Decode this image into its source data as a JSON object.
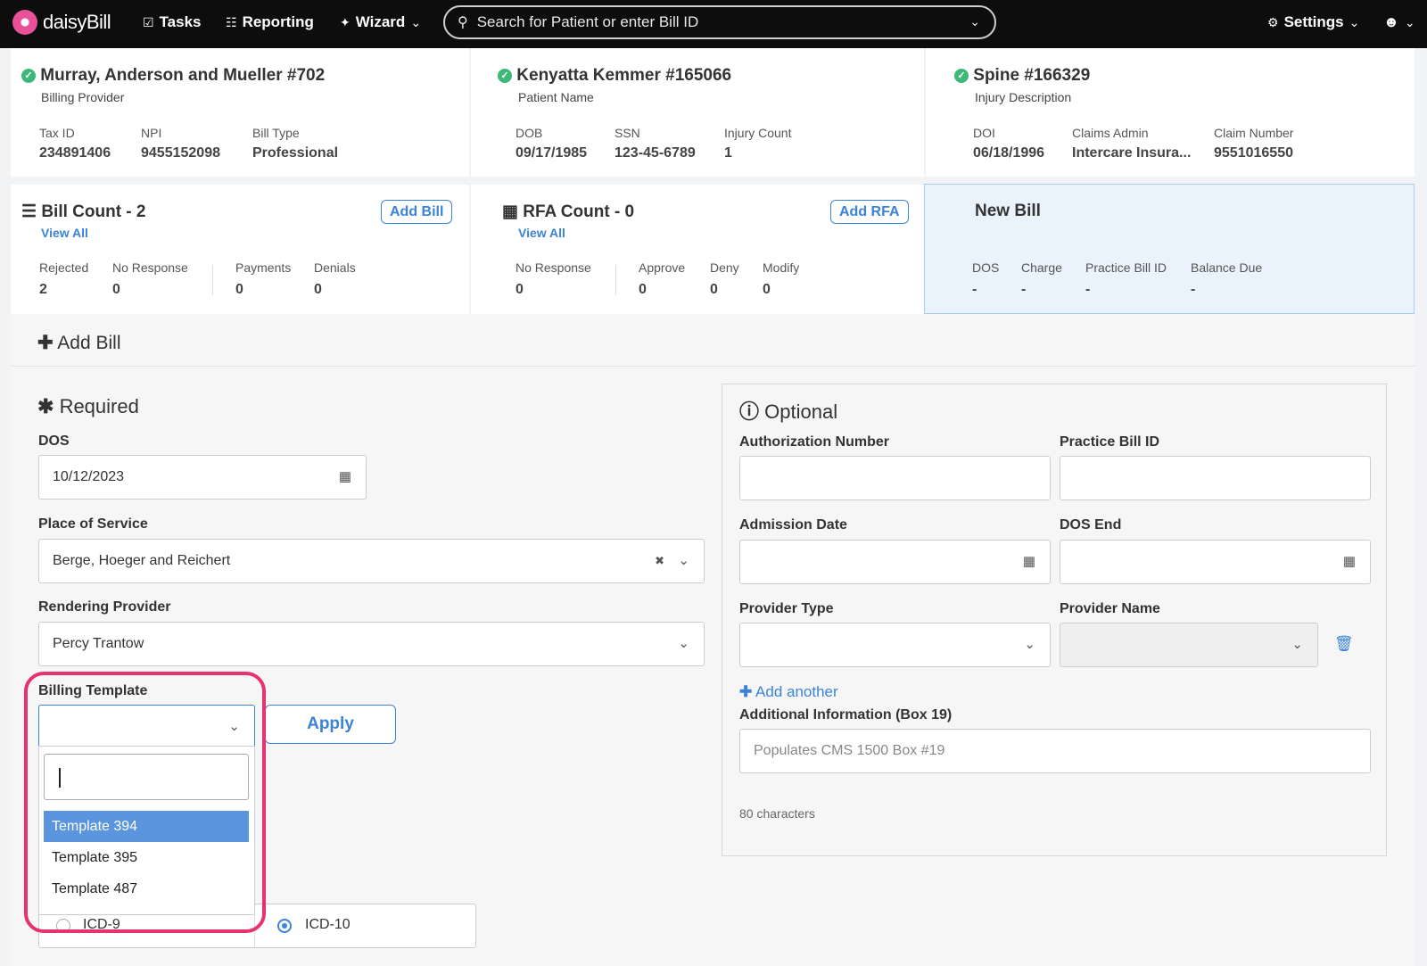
{
  "nav": {
    "brand": "daisyBill",
    "tasks": "Tasks",
    "reporting": "Reporting",
    "wizard": "Wizard",
    "search_placeholder": "Search for Patient or enter Bill ID",
    "settings": "Settings"
  },
  "provider_card": {
    "title": "Murray, Anderson and Mueller #702",
    "subtitle": "Billing Provider",
    "fields": [
      {
        "label": "Tax ID",
        "value": "234891406"
      },
      {
        "label": "NPI",
        "value": "9455152098"
      },
      {
        "label": "Bill Type",
        "value": "Professional"
      }
    ]
  },
  "patient_card": {
    "title": "Kenyatta Kemmer #165066",
    "subtitle": "Patient Name",
    "fields": [
      {
        "label": "DOB",
        "value": "09/17/1985"
      },
      {
        "label": "SSN",
        "value": "123-45-6789"
      },
      {
        "label": "Injury Count",
        "value": "1"
      }
    ]
  },
  "injury_card": {
    "title": "Spine #166329",
    "subtitle": "Injury Description",
    "fields": [
      {
        "label": "DOI",
        "value": "06/18/1996"
      },
      {
        "label": "Claims Admin",
        "value": "Intercare Insura..."
      },
      {
        "label": "Claim Number",
        "value": "9551016550"
      }
    ]
  },
  "bill_card": {
    "title": "Bill Count - 2",
    "view_all": "View All",
    "button": "Add Bill",
    "fields": [
      {
        "label": "Rejected",
        "value": "2"
      },
      {
        "label": "No Response",
        "value": "0"
      },
      {
        "label": "Payments",
        "value": "0"
      },
      {
        "label": "Denials",
        "value": "0"
      }
    ]
  },
  "rfa_card": {
    "title": "RFA Count - 0",
    "view_all": "View All",
    "button": "Add RFA",
    "fields": [
      {
        "label": "No Response",
        "value": "0"
      },
      {
        "label": "Approve",
        "value": "0"
      },
      {
        "label": "Deny",
        "value": "0"
      },
      {
        "label": "Modify",
        "value": "0"
      }
    ]
  },
  "new_bill_card": {
    "title": "New Bill",
    "fields": [
      {
        "label": "DOS",
        "value": "-"
      },
      {
        "label": "Charge",
        "value": "-"
      },
      {
        "label": "Practice Bill ID",
        "value": "-"
      },
      {
        "label": "Balance Due",
        "value": "-"
      }
    ]
  },
  "form": {
    "heading": "Add Bill",
    "required_heading": "Required",
    "optional_heading": "Optional",
    "dos_label": "DOS",
    "dos_value": "10/12/2023",
    "pos_label": "Place of Service",
    "pos_value": "Berge, Hoeger and Reichert",
    "rendering_label": "Rendering Provider",
    "rendering_value": "Percy Trantow",
    "template_label": "Billing Template",
    "apply": "Apply",
    "template_options": [
      "Template 394",
      "Template 395",
      "Template 487"
    ],
    "icd9": "ICD-9",
    "icd10": "ICD-10",
    "auth_label": "Authorization Number",
    "practice_bill_label": "Practice Bill ID",
    "admission_label": "Admission Date",
    "dos_end_label": "DOS End",
    "provider_type_label": "Provider Type",
    "provider_name_label": "Provider Name",
    "add_another": "Add another",
    "box19_label": "Additional Information (Box 19)",
    "box19_placeholder": "Populates CMS 1500 Box #19",
    "char_count": "80 characters"
  },
  "colors": {
    "accent": "#3b83d8",
    "highlight": "#e5336f",
    "check": "#3cb878"
  }
}
